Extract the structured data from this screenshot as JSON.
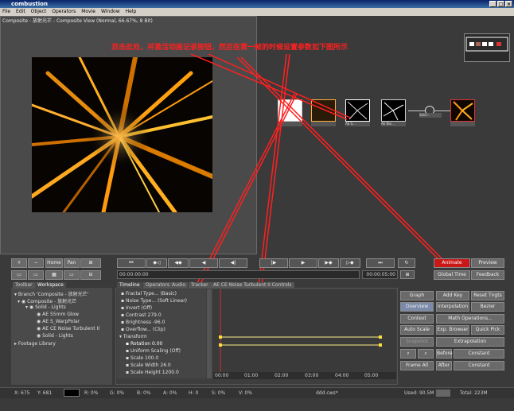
{
  "app": {
    "title": "combustion"
  },
  "menu": [
    "File",
    "Edit",
    "Object",
    "Operators",
    "Movie",
    "Window",
    "Help"
  ],
  "viewer": {
    "title": "Composite - 放射光芒 - Composite View (Normal, 66.67%, 8 Bit)"
  },
  "annotation": "双击此处，并激活动画记录按钮，然后在第一帧的时候设置参数如下图所示",
  "schematic": {
    "nodes": [
      "",
      "",
      "AE S...",
      "AE Noi...",
      "",
      "Solid -"
    ]
  },
  "viewer_controls": {
    "plus": "+",
    "minus": "−",
    "home": "Home",
    "pan": "Pan"
  },
  "transport": {
    "timecode_start": "00:00:00:00",
    "timecode_end": "00:00:05:00"
  },
  "right_buttons": {
    "animate": "Animate",
    "preview": "Preview",
    "global_time": "Global Time",
    "feedback": "Feedback"
  },
  "left_tabs": [
    "Toolbar",
    "Workspace"
  ],
  "tree": [
    "Branch 'Composite - 放射光芒'",
    "Composite - 放射光芒",
    "Solid - Lights",
    "AE 55mm Glow",
    "AE S_WarpPolar",
    "AE CE Noise Turbulent II",
    "Solid - Lights",
    "Footage Library"
  ],
  "timeline_tabs": [
    "Timeline",
    "Operators",
    "Audio",
    "Tracker",
    "AE CE Noise Turbulent II Controls"
  ],
  "params": [
    "Fractal Type...  (Basic)",
    "Noise Type...   (Soft Linear)",
    "Invert   (Off)",
    "Contrast  279.0",
    "Brightness  -96.0",
    "Overflow...   (Clip)",
    "Transform",
    "Rotation  0.00",
    "Uniform Scaling  (Off)",
    "Scale  100.0",
    "Scale Width  26.0",
    "Scale Height  1200.0"
  ],
  "ruler": [
    "00:00",
    "01:00",
    "02:00",
    "03:00",
    "04:00",
    "05:00"
  ],
  "graph_controls": {
    "graph": "Graph",
    "add_key": "Add Key",
    "reset_tngts": "Reset Tngts",
    "overview": "Overview",
    "interpolation": "Interpolation",
    "bezier": "Bezier",
    "context": "Context",
    "math_operations": "Math Operations...",
    "auto_scale": "Auto Scale",
    "exp_browser": "Exp. Browser",
    "quick_pick": "Quick Pick",
    "snapshot": "Snapshot",
    "extrapolation": "Extrapolation",
    "before": "Before",
    "constant_before": "Constant",
    "frame_all": "Frame All",
    "after": "After",
    "constant_after": "Constant"
  },
  "status": {
    "x": "X:  675",
    "y": "Y:  681",
    "r": "R:  0%",
    "g": "G:  0%",
    "b": "B:  0%",
    "a": "A:  0%",
    "h": "H:  0",
    "s": "S:  0%",
    "v": "V:  0%",
    "file": "ddd.cws*",
    "used": "Used:  90.5M",
    "total": "Total:  223M"
  }
}
